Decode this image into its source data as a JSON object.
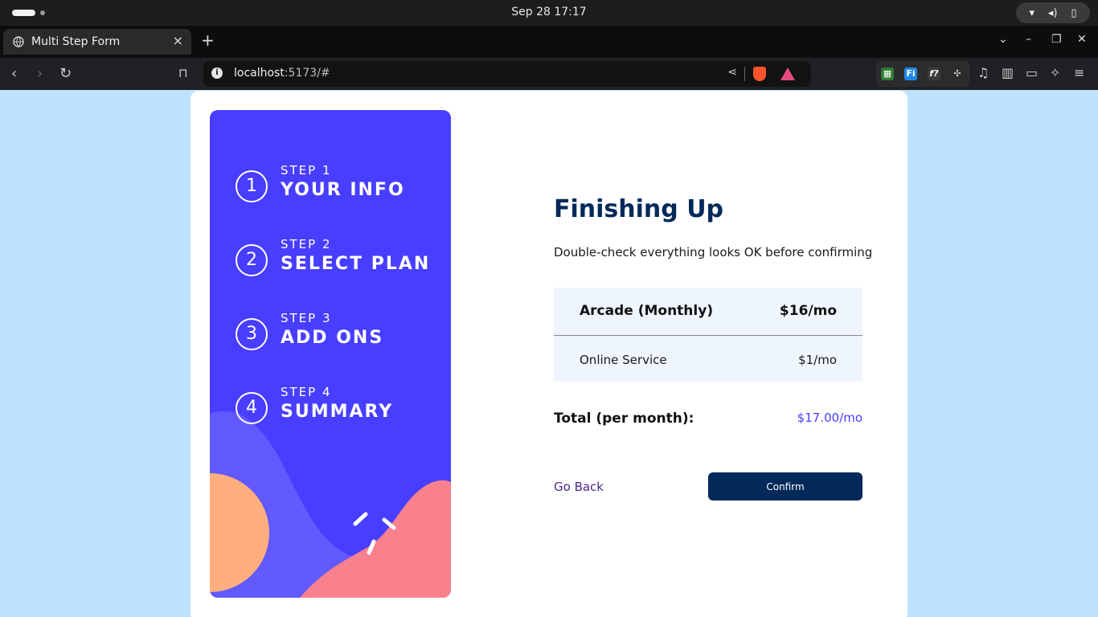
{
  "os": {
    "clock": "Sep 28  17:17"
  },
  "browser": {
    "tab_title": "Multi Step Form",
    "url_host": "localhost",
    "url_rest": ":5173/#"
  },
  "sidebar": {
    "steps": [
      {
        "number": "1",
        "label": "STEP 1",
        "title": "YOUR INFO"
      },
      {
        "number": "2",
        "label": "STEP 2",
        "title": "SELECT PLAN"
      },
      {
        "number": "3",
        "label": "STEP 3",
        "title": "ADD ONS"
      },
      {
        "number": "4",
        "label": "STEP 4",
        "title": "SUMMARY"
      }
    ]
  },
  "main": {
    "title": "Finishing Up",
    "subtitle": "Double-check everything looks OK before confirming",
    "plan": {
      "name": "Arcade (Monthly)",
      "price": "$16/mo"
    },
    "addons": [
      {
        "name": "Online Service",
        "price": "$1/mo"
      }
    ],
    "total": {
      "label": "Total (per month):",
      "value": "$17.00/mo"
    },
    "go_back_label": "Go Back",
    "confirm_label": "Confirm"
  },
  "colors": {
    "page_bg": "#bee2fd",
    "sidebar_bg": "#483eff",
    "title": "#02295a",
    "accent": "#483eff",
    "summary_bg": "#eef5ff",
    "confirm_bg": "#02295a"
  }
}
